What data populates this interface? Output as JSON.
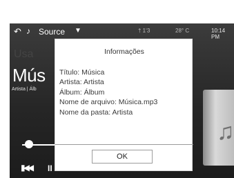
{
  "topbar": {
    "back_icon": "back-icon",
    "note_icon": "music-note-icon",
    "source_label": "Source",
    "caret_icon": "caret-down-icon",
    "status_faint_1": "† 1‘3",
    "status_faint_2": "28° C",
    "time": "10:14 PM"
  },
  "player": {
    "faint_label": "Usa",
    "title": "Mús",
    "artist": "Artista | Álb",
    "prev_icon": "previous-track-icon",
    "pause_icon": "pause-icon",
    "album_icon": "music-note-icon"
  },
  "dialog": {
    "title": "Informações",
    "lines": [
      "Título: Música",
      "Artista: Artista",
      "Álbum: Álbum",
      "Nome de arquivo: Música.mp3",
      "Nome da pasta: Artista"
    ],
    "ok_label": "OK"
  }
}
